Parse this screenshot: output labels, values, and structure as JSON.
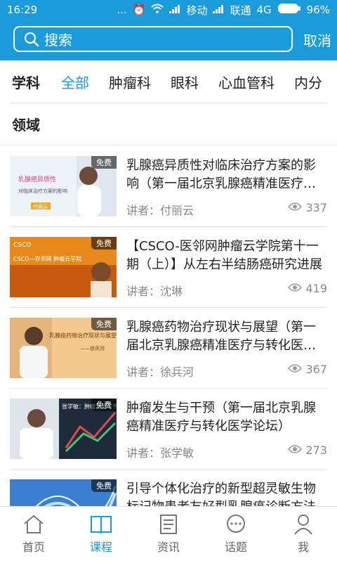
{
  "status_bar": {
    "time": "16:29",
    "dots": "...",
    "carrier1": "移动",
    "carrier2": "联通",
    "network": "4G",
    "battery": "96%"
  },
  "search": {
    "placeholder": "搜索",
    "cancel_label": "取消"
  },
  "categories": {
    "label": "学科",
    "tabs": [
      "全部",
      "肿瘤科",
      "眼科",
      "心血管科",
      "内分"
    ],
    "active_index": 0
  },
  "domain_label": "领域",
  "courses": [
    {
      "thumb_badge": "免费",
      "title": "乳腺癌异质性对临床治疗方案的影响（第一届北京乳腺癌精准医疗与转化医学论坛）",
      "speaker": "讲者：付丽云",
      "views": "337",
      "thumb_text_1": "乳腺癌异质性",
      "thumb_text_2": "对临床治疗方案的影响",
      "thumb_text_3": "付丽云"
    },
    {
      "thumb_badge": "免费",
      "title": "【CSCO-医邻网肿瘤云学院第十一期（上）】从左右半结肠癌研究进展",
      "speaker": "讲者：沈琳",
      "views": "419",
      "thumb_text_1": "CSCO",
      "thumb_text_2": "CSCO—亦邻网 肿瘤云学院",
      "thumb_text_3": ""
    },
    {
      "thumb_badge": "免费",
      "title": "乳腺癌药物治疗现状与展望（第一届北京乳腺癌精准医疗与转化医学论坛）",
      "speaker": "讲者：徐兵河",
      "views": "367",
      "thumb_text_1": "乳腺癌药物治疗现状与展望",
      "thumb_text_2": "——徐兵河",
      "thumb_text_3": ""
    },
    {
      "thumb_badge": "免费",
      "title": "肿瘤发生与干预（第一届北京乳腺癌精准医疗与转化医学论坛）",
      "speaker": "讲者：张学敏",
      "views": "273",
      "thumb_text_1": "张学敏：肿瘤发生与干预",
      "thumb_text_2": "",
      "thumb_text_3": ""
    },
    {
      "thumb_badge": "免费",
      "title": "引导个体化治疗的新型超灵敏生物标记物患者友好型乳腺癌诊断方法",
      "speaker": "",
      "views": "",
      "thumb_text_1": "",
      "thumb_text_2": "",
      "thumb_text_3": ""
    }
  ],
  "bottom_nav": [
    {
      "label": "首页",
      "icon": "home-icon"
    },
    {
      "label": "课程",
      "icon": "book-icon"
    },
    {
      "label": "资讯",
      "icon": "news-icon"
    },
    {
      "label": "话题",
      "icon": "chat-icon"
    },
    {
      "label": "我",
      "icon": "user-icon"
    }
  ],
  "bottom_nav_active": 1,
  "colors": {
    "accent": "#1a9bdb",
    "text": "#222222",
    "muted": "#888888"
  }
}
